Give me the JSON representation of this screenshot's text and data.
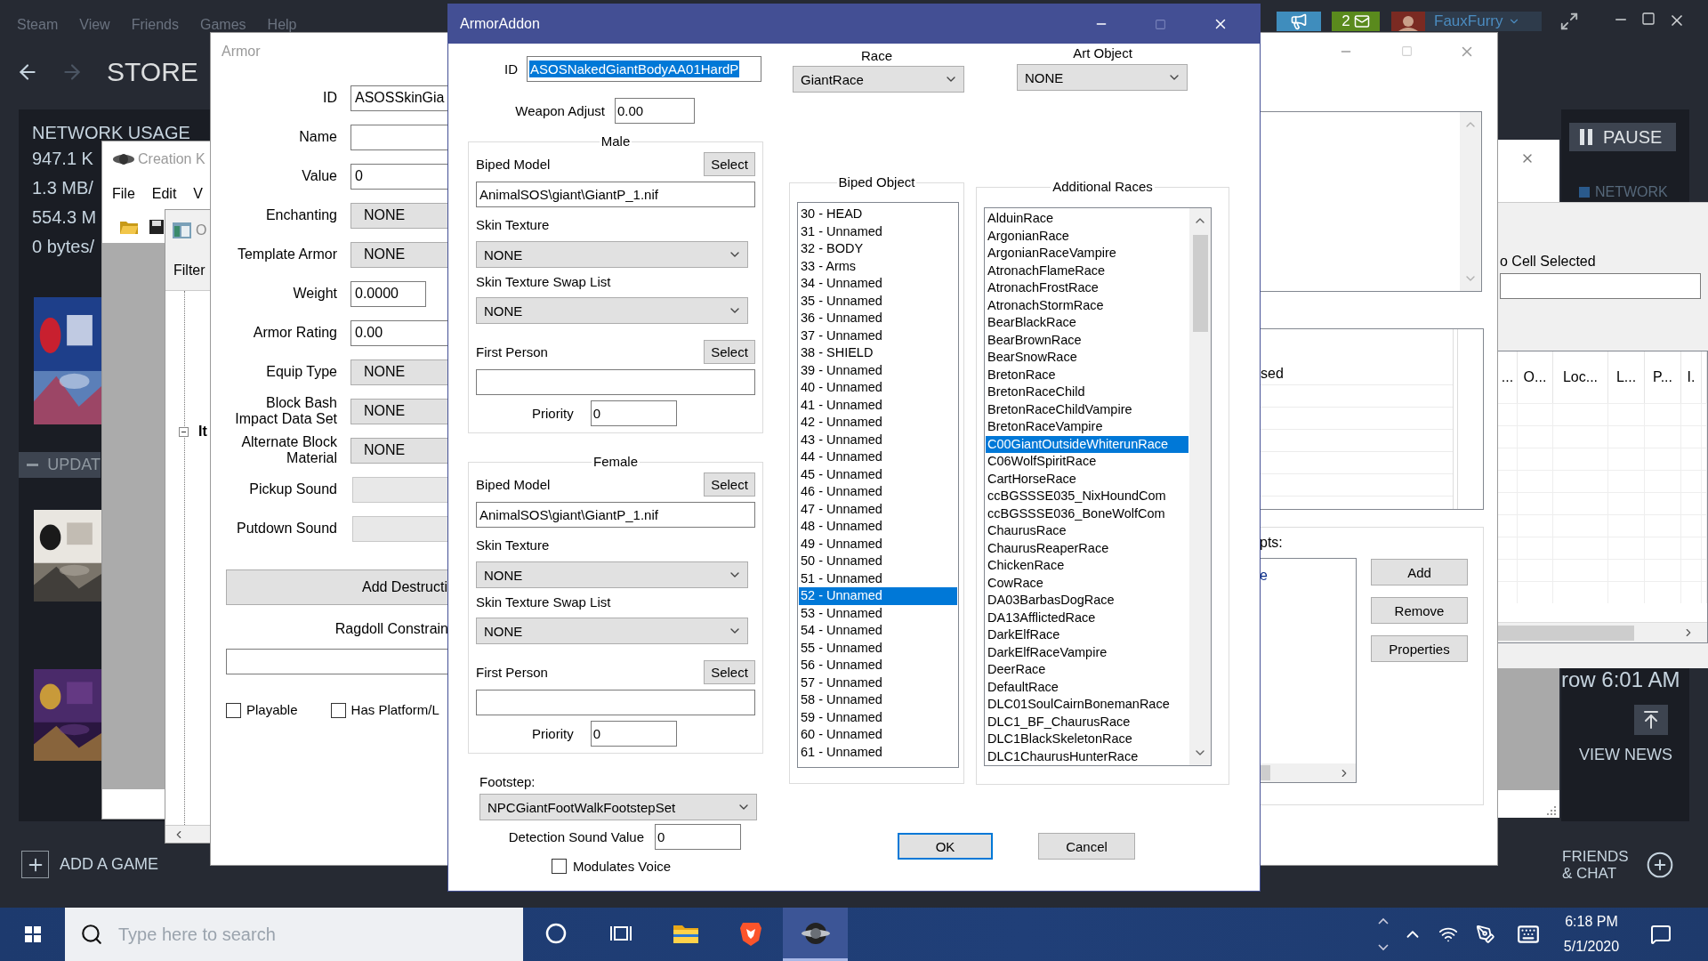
{
  "steam": {
    "menu": [
      "Steam",
      "View",
      "Friends",
      "Games",
      "Help"
    ],
    "notification_count": "2",
    "username": "FauxFurry",
    "page_title": "STORE",
    "network": {
      "title": "NETWORK USAGE",
      "lines": [
        "947.1 K",
        "1.3 MB/",
        "554.3 M",
        "0 bytes/"
      ]
    },
    "library": [
      {
        "kind": "game_tile"
      },
      {
        "kind": "section",
        "label": "UPDAT",
        "expanded": true
      },
      {
        "kind": "game_tile"
      },
      {
        "kind": "game_tile"
      }
    ],
    "add_game": "ADD A GAME",
    "pause": "PAUSE",
    "network_tab": "NETWORK",
    "news_time": "row 6:01 AM",
    "view_news": "VIEW NEWS",
    "friends_chat": "FRIENDS & CHAT"
  },
  "creation_kit": {
    "title": "Creation K",
    "menu": [
      "File",
      "Edit",
      "V"
    ],
    "object_window": {
      "title": "O",
      "filter_label": "Filter",
      "tree": [
        {
          "label": "It",
          "expanded": true
        }
      ]
    }
  },
  "armor": {
    "title": "Armor",
    "fields": [
      {
        "label": "ID",
        "kind": "text",
        "value": "ASOSSkinGia"
      },
      {
        "label": "Name",
        "kind": "text"
      },
      {
        "label": "Value",
        "kind": "text",
        "value": "0"
      },
      {
        "label": "Enchanting",
        "kind": "combo",
        "value": "NONE"
      },
      {
        "label": "Template Armor",
        "kind": "combo",
        "value": "NONE"
      },
      {
        "label": "Weight",
        "kind": "short",
        "value": "0.0000"
      },
      {
        "label": "Armor Rating",
        "kind": "text",
        "value": "0.00"
      },
      {
        "label": "Equip Type",
        "kind": "combo",
        "value": "NONE"
      },
      {
        "label": "Block Bash Impact Data Set",
        "kind": "combo",
        "value": "NONE"
      },
      {
        "label": "Alternate Block Material",
        "kind": "combo",
        "value": "NONE"
      },
      {
        "label": "Pickup Sound",
        "kind": "sound"
      },
      {
        "label": "Putdown Sound",
        "kind": "sound"
      }
    ],
    "add_destruction": "Add Destructi",
    "ragdoll_label": "Ragdoll Constrain",
    "checkboxes": [
      {
        "label": "Playable",
        "checked": false
      },
      {
        "label": "Has Platform/L",
        "checked": false
      }
    ],
    "list_row": "sed",
    "scripts_label": "pts:",
    "scripts": [
      "e"
    ],
    "script_buttons": [
      "Add",
      "Remove",
      "Properties"
    ]
  },
  "cell_view": {
    "status": "o Cell Selected",
    "columns": [
      "...",
      "O...",
      "Loc...",
      "L...",
      "P...",
      "I."
    ]
  },
  "armor_addon": {
    "title": "ArmorAddon",
    "id": {
      "label": "ID",
      "value": "ASOSNakedGiantBodyAA01HardP",
      "text_selected": true
    },
    "weapon_adjust": {
      "label": "Weapon Adjust",
      "value": "0.00"
    },
    "genders": [
      {
        "title": "Male",
        "biped_model": {
          "label": "Biped Model",
          "button": "Select",
          "value": "AnimalSOS\\giant\\GiantP_1.nif"
        },
        "skin_texture": {
          "label": "Skin Texture",
          "value": "NONE"
        },
        "swap_list": {
          "label": "Skin Texture Swap List",
          "value": "NONE"
        },
        "first_person": {
          "label": "First Person",
          "button": "Select"
        },
        "priority": {
          "label": "Priority",
          "value": "0"
        }
      },
      {
        "title": "Female",
        "biped_model": {
          "label": "Biped Model",
          "button": "Select",
          "value": "AnimalSOS\\giant\\GiantP_1.nif"
        },
        "skin_texture": {
          "label": "Skin Texture",
          "value": "NONE"
        },
        "swap_list": {
          "label": "Skin Texture Swap List",
          "value": "NONE"
        },
        "first_person": {
          "label": "First Person",
          "button": "Select"
        },
        "priority": {
          "label": "Priority",
          "value": "0"
        }
      }
    ],
    "footstep": {
      "label": "Footstep:",
      "value": "NPCGiantFootWalkFootstepSet"
    },
    "detection_sound": {
      "label": "Detection Sound Value",
      "value": "0"
    },
    "modulates_voice": {
      "label": "Modulates Voice",
      "checked": false
    },
    "race": {
      "label": "Race",
      "value": "GiantRace"
    },
    "art_object": {
      "label": "Art Object",
      "value": "NONE"
    },
    "biped_object": {
      "title": "Biped Object",
      "items": [
        {
          "label": "30 - HEAD",
          "selected": false
        },
        {
          "label": "31 - Unnamed",
          "selected": false
        },
        {
          "label": "32 - BODY",
          "selected": false
        },
        {
          "label": "33 - Arms",
          "selected": false
        },
        {
          "label": "34 - Unnamed",
          "selected": false
        },
        {
          "label": "35 - Unnamed",
          "selected": false
        },
        {
          "label": "36 - Unnamed",
          "selected": false
        },
        {
          "label": "37 - Unnamed",
          "selected": false
        },
        {
          "label": "38 - SHIELD",
          "selected": false
        },
        {
          "label": "39 - Unnamed",
          "selected": false
        },
        {
          "label": "40 - Unnamed",
          "selected": false
        },
        {
          "label": "41 - Unnamed",
          "selected": false
        },
        {
          "label": "42 - Unnamed",
          "selected": false
        },
        {
          "label": "43 - Unnamed",
          "selected": false
        },
        {
          "label": "44 - Unnamed",
          "selected": false
        },
        {
          "label": "45 - Unnamed",
          "selected": false
        },
        {
          "label": "46 - Unnamed",
          "selected": false
        },
        {
          "label": "47 - Unnamed",
          "selected": false
        },
        {
          "label": "48 - Unnamed",
          "selected": false
        },
        {
          "label": "49 - Unnamed",
          "selected": false
        },
        {
          "label": "50 - Unnamed",
          "selected": false
        },
        {
          "label": "51 - Unnamed",
          "selected": false
        },
        {
          "label": "52 - Unnamed",
          "selected": true
        },
        {
          "label": "53 - Unnamed",
          "selected": false
        },
        {
          "label": "54 - Unnamed",
          "selected": false
        },
        {
          "label": "55 - Unnamed",
          "selected": false
        },
        {
          "label": "56 - Unnamed",
          "selected": false
        },
        {
          "label": "57 - Unnamed",
          "selected": false
        },
        {
          "label": "58 - Unnamed",
          "selected": false
        },
        {
          "label": "59 - Unnamed",
          "selected": false
        },
        {
          "label": "60 - Unnamed",
          "selected": false
        },
        {
          "label": "61 - Unnamed",
          "selected": false
        }
      ]
    },
    "additional_races": {
      "title": "Additional Races",
      "items": [
        {
          "label": "AlduinRace",
          "selected": false
        },
        {
          "label": "ArgonianRace",
          "selected": false
        },
        {
          "label": "ArgonianRaceVampire",
          "selected": false
        },
        {
          "label": "AtronachFlameRace",
          "selected": false
        },
        {
          "label": "AtronachFrostRace",
          "selected": false
        },
        {
          "label": "AtronachStormRace",
          "selected": false
        },
        {
          "label": "BearBlackRace",
          "selected": false
        },
        {
          "label": "BearBrownRace",
          "selected": false
        },
        {
          "label": "BearSnowRace",
          "selected": false
        },
        {
          "label": "BretonRace",
          "selected": false
        },
        {
          "label": "BretonRaceChild",
          "selected": false
        },
        {
          "label": "BretonRaceChildVampire",
          "selected": false
        },
        {
          "label": "BretonRaceVampire",
          "selected": false
        },
        {
          "label": "C00GiantOutsideWhiterunRace",
          "selected": true
        },
        {
          "label": "C06WolfSpiritRace",
          "selected": false
        },
        {
          "label": "CartHorseRace",
          "selected": false
        },
        {
          "label": "ccBGSSSE035_NixHoundCom",
          "selected": false
        },
        {
          "label": "ccBGSSSE036_BoneWolfCom",
          "selected": false
        },
        {
          "label": "ChaurusRace",
          "selected": false
        },
        {
          "label": "ChaurusReaperRace",
          "selected": false
        },
        {
          "label": "ChickenRace",
          "selected": false
        },
        {
          "label": "CowRace",
          "selected": false
        },
        {
          "label": "DA03BarbasDogRace",
          "selected": false
        },
        {
          "label": "DA13AfflictedRace",
          "selected": false
        },
        {
          "label": "DarkElfRace",
          "selected": false
        },
        {
          "label": "DarkElfRaceVampire",
          "selected": false
        },
        {
          "label": "DeerRace",
          "selected": false
        },
        {
          "label": "DefaultRace",
          "selected": false
        },
        {
          "label": "DLC01SoulCairnBonemanRace",
          "selected": false
        },
        {
          "label": "DLC1_BF_ChaurusRace",
          "selected": false
        },
        {
          "label": "DLC1BlackSkeletonRace",
          "selected": false
        },
        {
          "label": "DLC1ChaurusHunterRace",
          "selected": false
        }
      ]
    },
    "buttons": [
      {
        "label": "OK",
        "default": true
      },
      {
        "label": "Cancel",
        "default": false
      }
    ]
  },
  "taskbar": {
    "search_placeholder": "Type here to search",
    "apps": [
      {
        "kind": "cortana",
        "active": false
      },
      {
        "kind": "task_view",
        "active": false
      },
      {
        "kind": "file_explorer",
        "active": false
      },
      {
        "kind": "brave",
        "active": false
      },
      {
        "kind": "creation_kit",
        "active": true
      }
    ],
    "time": "6:18 PM",
    "date": "5/1/2020"
  }
}
